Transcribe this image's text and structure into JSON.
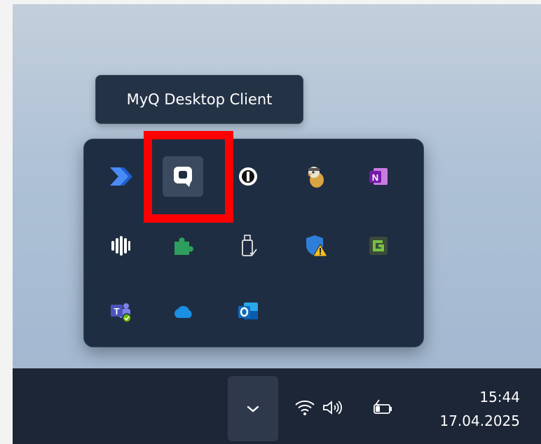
{
  "tooltip": {
    "text": "MyQ Desktop Client"
  },
  "overflow_icons": [
    {
      "name": "power-automate-icon",
      "color": "#2f6fe6"
    },
    {
      "name": "myq-icon",
      "color": "#ffffff"
    },
    {
      "name": "1password-icon",
      "color": "#ffffff"
    },
    {
      "name": "pidgin-icon",
      "color": "#d9a441"
    },
    {
      "name": "onenote-icon",
      "color": "#8a3fb8"
    },
    {
      "name": "audio-bars-icon",
      "color": "#ffffff"
    },
    {
      "name": "puzzle-icon",
      "color": "#2e9e5c"
    },
    {
      "name": "usb-drive-icon",
      "color": "#e6e6e6"
    },
    {
      "name": "windows-security-warning-icon",
      "color": "#2f7fd8"
    },
    {
      "name": "greenshot-icon",
      "color": "#76c043"
    },
    {
      "name": "teams-icon",
      "color": "#5b5fc7"
    },
    {
      "name": "onedrive-icon",
      "color": "#1a8fe3"
    },
    {
      "name": "outlook-icon",
      "color": "#1b6cc9"
    }
  ],
  "taskbar": {
    "time": "15:44",
    "date": "17.04.2025",
    "chevron_icon": "chevron-down-icon",
    "wifi_icon": "wifi-icon",
    "volume_icon": "speaker-icon",
    "battery_icon": "battery-charging-icon"
  },
  "colors": {
    "highlight": "#ff0000",
    "flyout_bg": "#1f2d42",
    "taskbar_bg": "#1c2636"
  }
}
